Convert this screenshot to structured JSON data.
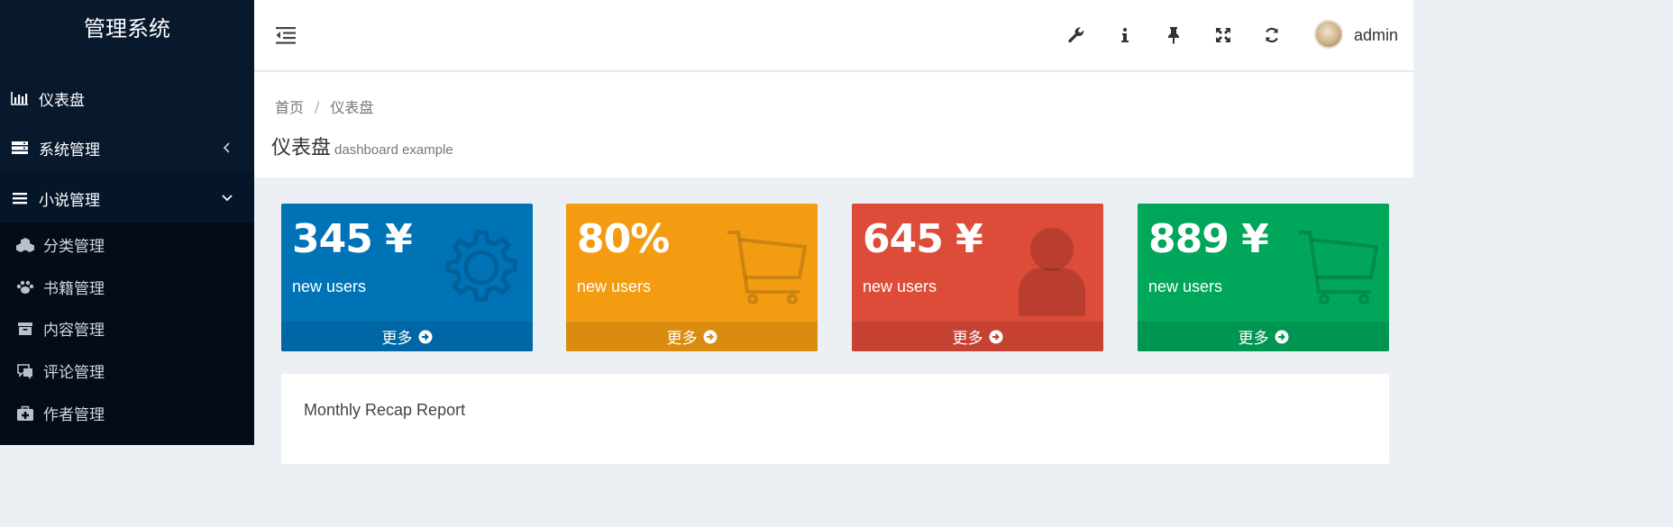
{
  "app": {
    "title": "管理系统"
  },
  "sidebar": {
    "items": [
      {
        "label": "仪表盘",
        "icon": "bar-chart-icon"
      },
      {
        "label": "系统管理",
        "icon": "server-icon",
        "caret": "chevron-left-icon"
      },
      {
        "label": "小说管理",
        "icon": "bars-icon",
        "caret": "chevron-down-icon"
      }
    ],
    "subitems": [
      {
        "label": "分类管理",
        "icon": "cubes-icon"
      },
      {
        "label": "书籍管理",
        "icon": "paw-icon"
      },
      {
        "label": "内容管理",
        "icon": "archive-icon"
      },
      {
        "label": "评论管理",
        "icon": "comments-icon"
      },
      {
        "label": "作者管理",
        "icon": "medkit-icon"
      }
    ]
  },
  "header": {
    "tools": [
      "wrench-icon",
      "info-icon",
      "thumbtack-icon",
      "expand-icon",
      "refresh-icon"
    ],
    "user": "admin"
  },
  "breadcrumb": {
    "home": "首页",
    "separator": "/",
    "current": "仪表盘"
  },
  "page": {
    "title": "仪表盘",
    "subtitle": "dashboard example"
  },
  "stats": [
    {
      "value": "345 ¥",
      "label": "new users",
      "more": "更多",
      "icon": "gear-icon",
      "color": "#0073b7",
      "footer_color": "#0067a4"
    },
    {
      "value": "80%",
      "label": "new users",
      "more": "更多",
      "icon": "shopping-cart-icon",
      "color": "#f39c12",
      "footer_color": "#da8c10"
    },
    {
      "value": "645 ¥",
      "label": "new users",
      "more": "更多",
      "icon": "user-icon",
      "color": "#dd4b39",
      "footer_color": "#c64333"
    },
    {
      "value": "889 ¥",
      "label": "new users",
      "more": "更多",
      "icon": "shopping-cart-icon",
      "color": "#00a65a",
      "footer_color": "#009551"
    }
  ],
  "panel": {
    "title": "Monthly Recap Report"
  }
}
